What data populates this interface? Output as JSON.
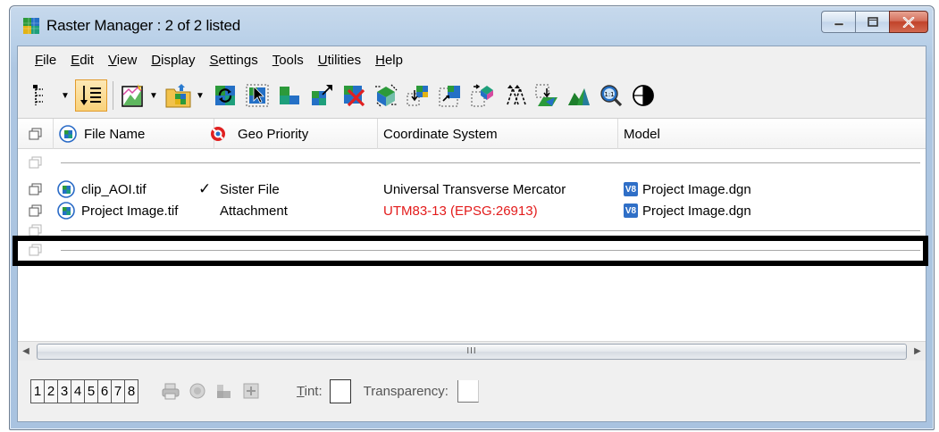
{
  "window": {
    "title": "Raster Manager : 2 of 2 listed"
  },
  "menu": [
    {
      "label": "File",
      "key": "F",
      "rest": "ile"
    },
    {
      "label": "Edit",
      "key": "E",
      "rest": "dit"
    },
    {
      "label": "View",
      "key": "V",
      "rest": "iew"
    },
    {
      "label": "Display",
      "key": "D",
      "rest": "isplay"
    },
    {
      "label": "Settings",
      "key": "S",
      "rest": "ettings"
    },
    {
      "label": "Tools",
      "key": "T",
      "rest": "ools"
    },
    {
      "label": "Utilities",
      "key": "U",
      "rest": "tilities"
    },
    {
      "label": "Help",
      "key": "H",
      "rest": "elp"
    }
  ],
  "table": {
    "headers": {
      "file_name": "File Name",
      "geo_priority": "Geo Priority",
      "coordinate_system": "Coordinate System",
      "model": "Model"
    },
    "rows": [
      {
        "file_name": "clip_AOI.tif",
        "checked": "✓",
        "geo_priority": "Sister File",
        "coordinate_system": "Universal Transverse Mercator",
        "model": "Project Image.dgn"
      },
      {
        "file_name": "Project Image.tif",
        "checked": "",
        "geo_priority": "Attachment",
        "coordinate_system": "UTM83-13 (EPSG:26913)",
        "model": "Project Image.dgn"
      }
    ],
    "model_badge": "V8"
  },
  "scrollbar": {
    "grip": "III"
  },
  "footer": {
    "views": [
      "1",
      "2",
      "3",
      "4",
      "5",
      "6",
      "7",
      "8"
    ],
    "tint_label": "Tint:",
    "tint_key": "T",
    "tint_rest": "int:",
    "transparency_label": "Transparency:"
  },
  "colors": {
    "highlight_text": "#e31b1b",
    "selection_frame": "#000000"
  }
}
